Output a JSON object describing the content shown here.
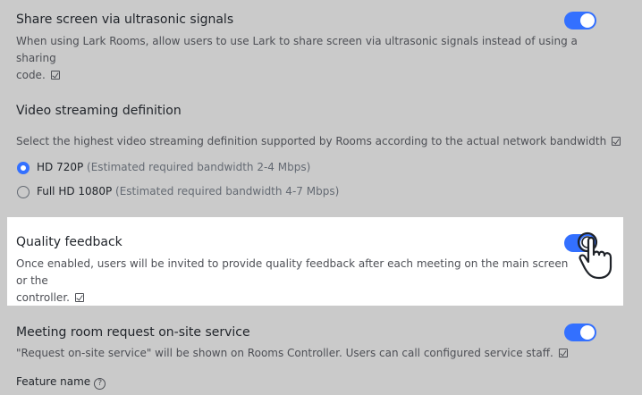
{
  "sections": {
    "ultrasonic": {
      "title": "Share screen via ultrasonic signals",
      "desc_line1": "When using Lark Rooms, allow users to use Lark to share screen via ultrasonic signals instead of using a sharing",
      "desc_line2": "code.",
      "enabled": true
    },
    "video": {
      "title": "Video streaming definition",
      "desc": "Select the highest video streaming definition supported by Rooms according to the actual network bandwidth",
      "options": [
        {
          "label": "HD 720P",
          "hint": "(Estimated required bandwidth 2-4 Mbps)",
          "selected": true
        },
        {
          "label": "Full HD 1080P",
          "hint": "(Estimated required bandwidth 4-7 Mbps)",
          "selected": false
        }
      ]
    },
    "quality": {
      "title": "Quality feedback",
      "desc_line1": "Once enabled, users will be invited to provide quality feedback after each meeting on the main screen or the",
      "desc_line2": "controller.",
      "enabled": true
    },
    "onsite": {
      "title": "Meeting room request on-site service",
      "desc": "\"Request on-site service\" will be shown on Rooms Controller. Users can call configured service staff.",
      "enabled": true,
      "feature_label": "Feature name"
    }
  },
  "colors": {
    "accent": "#3370ff",
    "overlay_bg": "#cacaca",
    "highlight_bg": "#ffffff"
  },
  "icons": {
    "external": "external-link-icon",
    "help": "question-circle-icon",
    "cursor": "hand-pointer-icon"
  }
}
